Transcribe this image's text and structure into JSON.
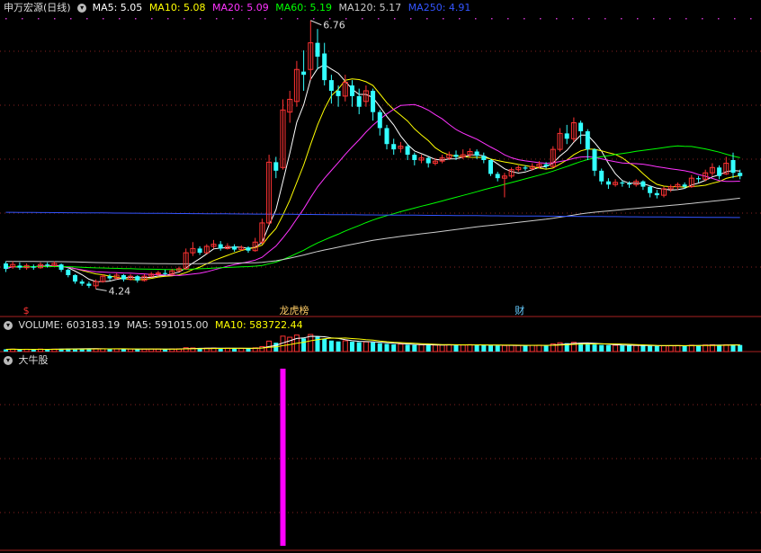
{
  "header": {
    "title": "申万宏源(日线)",
    "ma": [
      {
        "label": "MA5: 5.05",
        "color": "#ffffff"
      },
      {
        "label": "MA10: 5.08",
        "color": "#ffff00"
      },
      {
        "label": "MA20: 5.09",
        "color": "#ff33ff"
      },
      {
        "label": "MA60: 5.19",
        "color": "#00ff00"
      },
      {
        "label": "MA120: 5.17",
        "color": "#cccccc"
      },
      {
        "label": "MA250: 4.91",
        "color": "#3355ff"
      }
    ]
  },
  "volume_header": {
    "label": "VOLUME: 603183.19",
    "ma5": "MA5: 591015.00",
    "ma10": "MA10: 583722.44"
  },
  "indicator_header": {
    "label": "大牛股"
  },
  "markers": [
    {
      "text": "$",
      "color": "#ff3333",
      "index": 3
    },
    {
      "text": "龙虎榜",
      "color": "#ffcc66",
      "index": 40
    },
    {
      "text": "财",
      "color": "#66ccff",
      "index": 74
    }
  ],
  "colors": {
    "up": "#ff3333",
    "down": "#33ffff",
    "grid": "#882222",
    "signal": "#ff00ff"
  },
  "chart_data": [
    {
      "type": "candlestick",
      "title": "申万宏源(日线)",
      "ylim": [
        4.1,
        6.8
      ],
      "annotations": [
        {
          "text": "6.76",
          "index": 44,
          "value": 6.76
        },
        {
          "text": "4.24",
          "index": 13,
          "value": 4.24
        }
      ],
      "candles": [
        {
          "o": 4.48,
          "c": 4.43,
          "h": 4.5,
          "l": 4.4
        },
        {
          "o": 4.45,
          "c": 4.47,
          "h": 4.5,
          "l": 4.43
        },
        {
          "o": 4.46,
          "c": 4.44,
          "h": 4.49,
          "l": 4.42
        },
        {
          "o": 4.44,
          "c": 4.46,
          "h": 4.48,
          "l": 4.42
        },
        {
          "o": 4.45,
          "c": 4.44,
          "h": 4.47,
          "l": 4.42
        },
        {
          "o": 4.44,
          "c": 4.47,
          "h": 4.49,
          "l": 4.43
        },
        {
          "o": 4.47,
          "c": 4.46,
          "h": 4.49,
          "l": 4.44
        },
        {
          "o": 4.46,
          "c": 4.48,
          "h": 4.5,
          "l": 4.45
        },
        {
          "o": 4.47,
          "c": 4.42,
          "h": 4.48,
          "l": 4.4
        },
        {
          "o": 4.42,
          "c": 4.37,
          "h": 4.43,
          "l": 4.35
        },
        {
          "o": 4.37,
          "c": 4.31,
          "h": 4.38,
          "l": 4.29
        },
        {
          "o": 4.31,
          "c": 4.29,
          "h": 4.33,
          "l": 4.27
        },
        {
          "o": 4.29,
          "c": 4.27,
          "h": 4.31,
          "l": 4.25
        },
        {
          "o": 4.27,
          "c": 4.31,
          "h": 4.33,
          "l": 4.24
        },
        {
          "o": 4.31,
          "c": 4.36,
          "h": 4.38,
          "l": 4.3
        },
        {
          "o": 4.36,
          "c": 4.34,
          "h": 4.38,
          "l": 4.32
        },
        {
          "o": 4.34,
          "c": 4.37,
          "h": 4.39,
          "l": 4.33
        },
        {
          "o": 4.37,
          "c": 4.33,
          "h": 4.38,
          "l": 4.31
        },
        {
          "o": 4.33,
          "c": 4.36,
          "h": 4.38,
          "l": 4.32
        },
        {
          "o": 4.36,
          "c": 4.32,
          "h": 4.37,
          "l": 4.3
        },
        {
          "o": 4.32,
          "c": 4.36,
          "h": 4.38,
          "l": 4.31
        },
        {
          "o": 4.36,
          "c": 4.38,
          "h": 4.4,
          "l": 4.35
        },
        {
          "o": 4.38,
          "c": 4.39,
          "h": 4.41,
          "l": 4.36
        },
        {
          "o": 4.39,
          "c": 4.38,
          "h": 4.42,
          "l": 4.37
        },
        {
          "o": 4.38,
          "c": 4.41,
          "h": 4.43,
          "l": 4.37
        },
        {
          "o": 4.41,
          "c": 4.43,
          "h": 4.45,
          "l": 4.4
        },
        {
          "o": 4.43,
          "c": 4.58,
          "h": 4.62,
          "l": 4.42
        },
        {
          "o": 4.58,
          "c": 4.62,
          "h": 4.68,
          "l": 4.55
        },
        {
          "o": 4.62,
          "c": 4.58,
          "h": 4.64,
          "l": 4.56
        },
        {
          "o": 4.58,
          "c": 4.64,
          "h": 4.66,
          "l": 4.57
        },
        {
          "o": 4.64,
          "c": 4.66,
          "h": 4.7,
          "l": 4.62
        },
        {
          "o": 4.66,
          "c": 4.62,
          "h": 4.69,
          "l": 4.6
        },
        {
          "o": 4.62,
          "c": 4.64,
          "h": 4.67,
          "l": 4.61
        },
        {
          "o": 4.64,
          "c": 4.61,
          "h": 4.66,
          "l": 4.59
        },
        {
          "o": 4.61,
          "c": 4.63,
          "h": 4.65,
          "l": 4.6
        },
        {
          "o": 4.63,
          "c": 4.6,
          "h": 4.64,
          "l": 4.58
        },
        {
          "o": 4.6,
          "c": 4.68,
          "h": 4.72,
          "l": 4.59
        },
        {
          "o": 4.68,
          "c": 4.86,
          "h": 4.9,
          "l": 4.66
        },
        {
          "o": 4.86,
          "c": 5.43,
          "h": 5.5,
          "l": 4.84
        },
        {
          "o": 5.43,
          "c": 5.35,
          "h": 5.48,
          "l": 5.28
        },
        {
          "o": 5.38,
          "c": 5.92,
          "h": 6.02,
          "l": 5.36
        },
        {
          "o": 5.9,
          "c": 6.02,
          "h": 6.1,
          "l": 5.8
        },
        {
          "o": 6.0,
          "c": 6.3,
          "h": 6.38,
          "l": 5.95
        },
        {
          "o": 6.28,
          "c": 6.25,
          "h": 6.48,
          "l": 6.1
        },
        {
          "o": 6.3,
          "c": 6.55,
          "h": 6.76,
          "l": 6.2
        },
        {
          "o": 6.55,
          "c": 6.42,
          "h": 6.68,
          "l": 6.3
        },
        {
          "o": 6.45,
          "c": 6.2,
          "h": 6.55,
          "l": 6.15
        },
        {
          "o": 6.2,
          "c": 6.1,
          "h": 6.25,
          "l": 5.98
        },
        {
          "o": 6.1,
          "c": 6.05,
          "h": 6.15,
          "l": 5.95
        },
        {
          "o": 6.05,
          "c": 6.18,
          "h": 6.25,
          "l": 6.0
        },
        {
          "o": 6.15,
          "c": 6.05,
          "h": 6.2,
          "l": 5.95
        },
        {
          "o": 6.05,
          "c": 5.95,
          "h": 6.12,
          "l": 5.88
        },
        {
          "o": 6.0,
          "c": 6.1,
          "h": 6.15,
          "l": 5.95
        },
        {
          "o": 6.1,
          "c": 5.9,
          "h": 6.12,
          "l": 5.82
        },
        {
          "o": 5.9,
          "c": 5.75,
          "h": 5.92,
          "l": 5.68
        },
        {
          "o": 5.75,
          "c": 5.6,
          "h": 5.78,
          "l": 5.55
        },
        {
          "o": 5.6,
          "c": 5.55,
          "h": 5.65,
          "l": 5.5
        },
        {
          "o": 5.56,
          "c": 5.58,
          "h": 5.62,
          "l": 5.52
        },
        {
          "o": 5.58,
          "c": 5.5,
          "h": 5.6,
          "l": 5.45
        },
        {
          "o": 5.5,
          "c": 5.45,
          "h": 5.52,
          "l": 5.4
        },
        {
          "o": 5.45,
          "c": 5.47,
          "h": 5.5,
          "l": 5.42
        },
        {
          "o": 5.47,
          "c": 5.42,
          "h": 5.48,
          "l": 5.38
        },
        {
          "o": 5.42,
          "c": 5.44,
          "h": 5.47,
          "l": 5.4
        },
        {
          "o": 5.44,
          "c": 5.47,
          "h": 5.5,
          "l": 5.42
        },
        {
          "o": 5.47,
          "c": 5.5,
          "h": 5.53,
          "l": 5.45
        },
        {
          "o": 5.5,
          "c": 5.48,
          "h": 5.54,
          "l": 5.45
        },
        {
          "o": 5.48,
          "c": 5.5,
          "h": 5.55,
          "l": 5.46
        },
        {
          "o": 5.5,
          "c": 5.53,
          "h": 5.56,
          "l": 5.47
        },
        {
          "o": 5.53,
          "c": 5.49,
          "h": 5.55,
          "l": 5.46
        },
        {
          "o": 5.49,
          "c": 5.45,
          "h": 5.52,
          "l": 5.42
        },
        {
          "o": 5.45,
          "c": 5.32,
          "h": 5.46,
          "l": 5.3
        },
        {
          "o": 5.32,
          "c": 5.28,
          "h": 5.34,
          "l": 5.25
        },
        {
          "o": 5.28,
          "c": 5.3,
          "h": 5.33,
          "l": 5.1
        },
        {
          "o": 5.3,
          "c": 5.36,
          "h": 5.38,
          "l": 5.28
        },
        {
          "o": 5.36,
          "c": 5.38,
          "h": 5.4,
          "l": 5.34
        },
        {
          "o": 5.38,
          "c": 5.37,
          "h": 5.4,
          "l": 5.35
        },
        {
          "o": 5.37,
          "c": 5.39,
          "h": 5.42,
          "l": 5.35
        },
        {
          "o": 5.39,
          "c": 5.41,
          "h": 5.44,
          "l": 5.37
        },
        {
          "o": 5.41,
          "c": 5.39,
          "h": 5.43,
          "l": 5.37
        },
        {
          "o": 5.39,
          "c": 5.55,
          "h": 5.58,
          "l": 5.38
        },
        {
          "o": 5.55,
          "c": 5.7,
          "h": 5.75,
          "l": 5.53
        },
        {
          "o": 5.7,
          "c": 5.65,
          "h": 5.78,
          "l": 5.6
        },
        {
          "o": 5.65,
          "c": 5.8,
          "h": 5.85,
          "l": 5.62
        },
        {
          "o": 5.8,
          "c": 5.72,
          "h": 5.82,
          "l": 5.6
        },
        {
          "o": 5.72,
          "c": 5.55,
          "h": 5.74,
          "l": 5.45
        },
        {
          "o": 5.55,
          "c": 5.35,
          "h": 5.56,
          "l": 5.3
        },
        {
          "o": 5.35,
          "c": 5.25,
          "h": 5.37,
          "l": 5.22
        },
        {
          "o": 5.25,
          "c": 5.22,
          "h": 5.28,
          "l": 5.18
        },
        {
          "o": 5.22,
          "c": 5.24,
          "h": 5.27,
          "l": 5.2
        },
        {
          "o": 5.24,
          "c": 5.23,
          "h": 5.26,
          "l": 5.2
        },
        {
          "o": 5.23,
          "c": 5.22,
          "h": 5.25,
          "l": 5.19
        },
        {
          "o": 5.22,
          "c": 5.25,
          "h": 5.27,
          "l": 5.2
        },
        {
          "o": 5.25,
          "c": 5.2,
          "h": 5.26,
          "l": 5.17
        },
        {
          "o": 5.2,
          "c": 5.14,
          "h": 5.21,
          "l": 5.1
        },
        {
          "o": 5.14,
          "c": 5.12,
          "h": 5.17,
          "l": 5.09
        },
        {
          "o": 5.12,
          "c": 5.18,
          "h": 5.2,
          "l": 5.1
        },
        {
          "o": 5.18,
          "c": 5.2,
          "h": 5.22,
          "l": 5.15
        },
        {
          "o": 5.2,
          "c": 5.22,
          "h": 5.24,
          "l": 5.17
        },
        {
          "o": 5.22,
          "c": 5.2,
          "h": 5.24,
          "l": 5.18
        },
        {
          "o": 5.2,
          "c": 5.28,
          "h": 5.31,
          "l": 5.19
        },
        {
          "o": 5.28,
          "c": 5.27,
          "h": 5.3,
          "l": 5.24
        },
        {
          "o": 5.27,
          "c": 5.33,
          "h": 5.36,
          "l": 5.25
        },
        {
          "o": 5.33,
          "c": 5.38,
          "h": 5.42,
          "l": 5.3
        },
        {
          "o": 5.38,
          "c": 5.3,
          "h": 5.4,
          "l": 5.27
        },
        {
          "o": 5.32,
          "c": 5.42,
          "h": 5.48,
          "l": 5.31
        },
        {
          "o": 5.45,
          "c": 5.33,
          "h": 5.52,
          "l": 5.28
        },
        {
          "o": 5.33,
          "c": 5.3,
          "h": 5.36,
          "l": 5.27
        }
      ],
      "ma": [
        {
          "name": "MA5",
          "color": "#ffffff",
          "period": 5
        },
        {
          "name": "MA10",
          "color": "#ffff00",
          "period": 10
        },
        {
          "name": "MA20",
          "color": "#ff33ff",
          "period": 20
        },
        {
          "name": "MA60",
          "color": "#00ff00",
          "period": 60
        },
        {
          "name": "MA120",
          "color": "#cccccc",
          "period": 120
        },
        {
          "name": "MA250",
          "color": "#3355ff",
          "period": 250
        }
      ]
    },
    {
      "type": "bar",
      "title": "VOLUME",
      "values": [
        20,
        22,
        18,
        21,
        19,
        23,
        20,
        22,
        26,
        28,
        27,
        25,
        24,
        26,
        25,
        23,
        24,
        22,
        23,
        21,
        22,
        24,
        23,
        22,
        24,
        25,
        35,
        33,
        30,
        31,
        32,
        29,
        30,
        28,
        29,
        27,
        34,
        45,
        95,
        80,
        140,
        130,
        150,
        120,
        155,
        135,
        115,
        100,
        92,
        98,
        90,
        85,
        88,
        84,
        76,
        70,
        66,
        68,
        62,
        60,
        61,
        58,
        59,
        60,
        62,
        61,
        60,
        63,
        61,
        58,
        56,
        54,
        55,
        57,
        56,
        55,
        57,
        58,
        57,
        70,
        80,
        76,
        84,
        78,
        72,
        64,
        60,
        58,
        57,
        56,
        55,
        56,
        54,
        52,
        51,
        53,
        54,
        55,
        54,
        58,
        57,
        60,
        62,
        58,
        62,
        64,
        60
      ],
      "ma5": 591015.0,
      "ma10": 583722.44,
      "last": 603183.19
    },
    {
      "type": "bar",
      "title": "大牛股",
      "signals": [
        40
      ]
    }
  ]
}
